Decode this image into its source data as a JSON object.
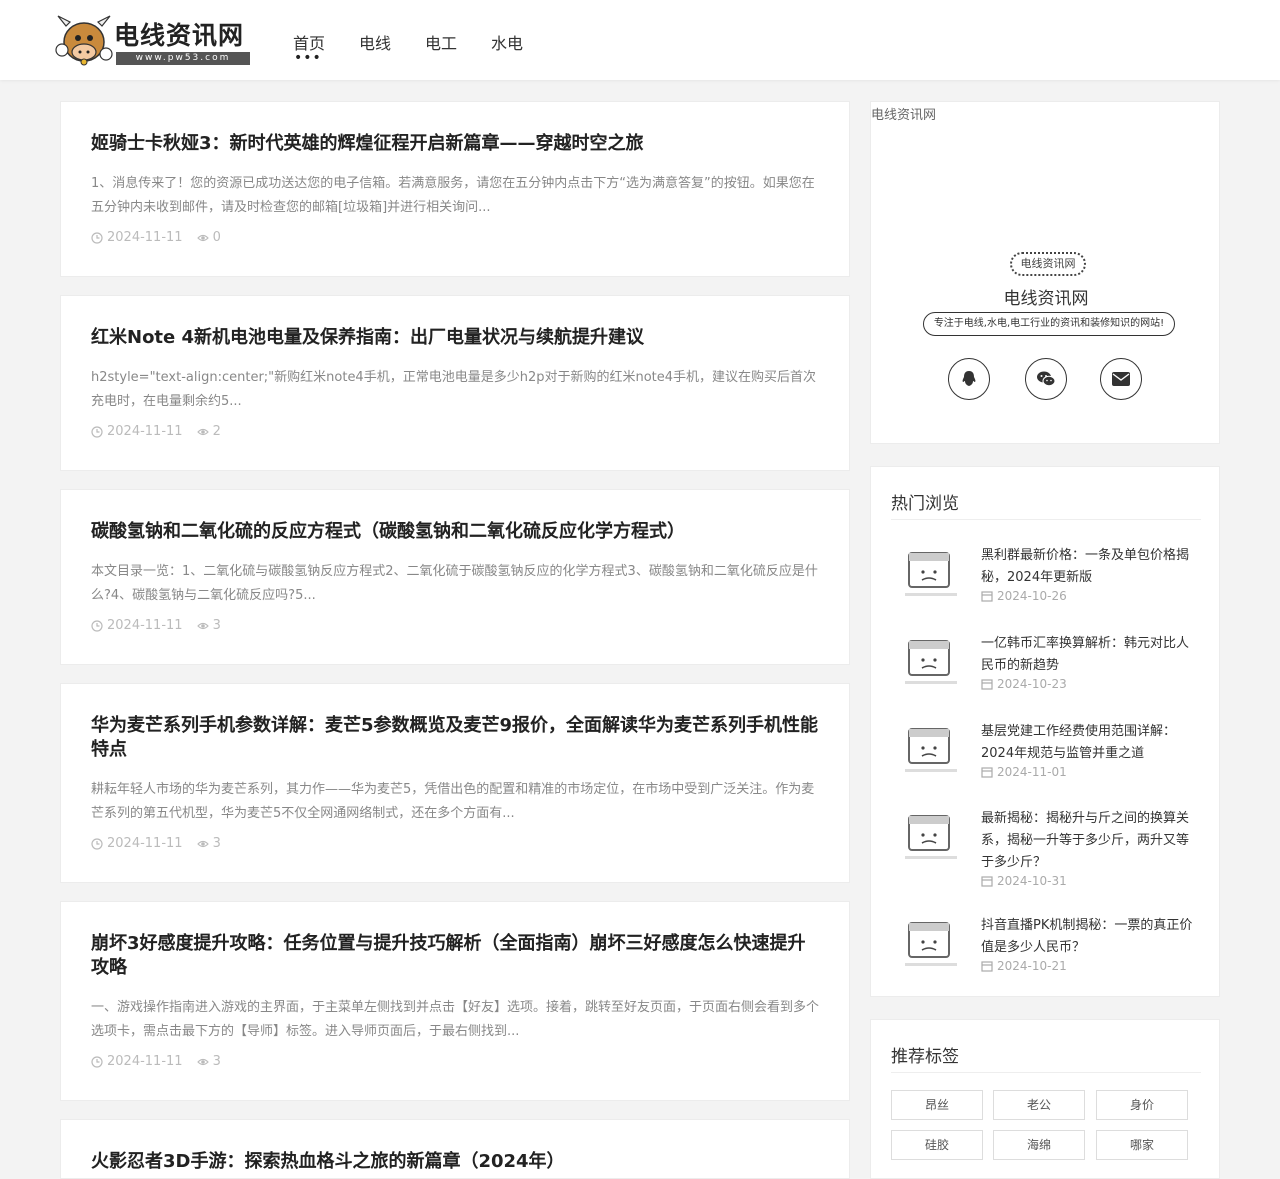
{
  "site": {
    "logo_title": "电线资讯网",
    "logo_domain": "www.pw53.com"
  },
  "nav": [
    {
      "label": "首页",
      "active": true
    },
    {
      "label": "电线",
      "active": false
    },
    {
      "label": "电工",
      "active": false
    },
    {
      "label": "水电",
      "active": false
    }
  ],
  "articles": [
    {
      "title": "姬骑士卡秋娅3：新时代英雄的辉煌征程开启新篇章——穿越时空之旅",
      "excerpt": "1、消息传来了！您的资源已成功送达您的电子信箱。若满意服务，请您在五分钟内点击下方“选为满意答复”的按钮。如果您在五分钟内未收到邮件，请及时检查您的邮箱[垃圾箱]并进行相关询问...",
      "date": "2024-11-11",
      "views": "0"
    },
    {
      "title": "红米Note 4新机电池电量及保养指南：出厂电量状况与续航提升建议",
      "excerpt": "h2style=\"text-align:center;\"新购红米note4手机，正常电池电量是多少h2p对于新购的红米note4手机，建议在购买后首次充电时，在电量剩余约5...",
      "date": "2024-11-11",
      "views": "2"
    },
    {
      "title": "碳酸氢钠和二氧化硫的反应方程式（碳酸氢钠和二氧化硫反应化学方程式）",
      "excerpt": "本文目录一览：1、二氧化硫与碳酸氢钠反应方程式2、二氧化硫于碳酸氢钠反应的化学方程式3、碳酸氢钠和二氧化硫反应是什么?4、碳酸氢钠与二氧化硫反应吗?5...",
      "date": "2024-11-11",
      "views": "3"
    },
    {
      "title": "华为麦芒系列手机参数详解：麦芒5参数概览及麦芒9报价，全面解读华为麦芒系列手机性能特点",
      "excerpt": "耕耘年轻人市场的华为麦芒系列，其力作——华为麦芒5，凭借出色的配置和精准的市场定位，在市场中受到广泛关注。作为麦芒系列的第五代机型，华为麦芒5不仅全网通网络制式，还在多个方面有...",
      "date": "2024-11-11",
      "views": "3"
    },
    {
      "title": "崩坏3好感度提升攻略：任务位置与提升技巧解析（全面指南）崩坏三好感度怎么快速提升攻略",
      "excerpt": "一、游戏操作指南进入游戏的主界面，于主菜单左侧找到并点击【好友】选项。接着，跳转至好友页面，于页面右侧会看到多个选项卡，需点击最下方的【导师】标签。进入导师页面后，于最右侧找到...",
      "date": "2024-11-11",
      "views": "3"
    },
    {
      "title": "火影忍者3D手游：探索热血格斗之旅的新篇章（2024年）",
      "excerpt": "",
      "date": "",
      "views": ""
    }
  ],
  "profile": {
    "label": "电线资讯网",
    "badge": "电线资讯网",
    "name": "电线资讯网",
    "desc": "专注于电线,水电,电工行业的资讯和装修知识的网站!",
    "socials": [
      "qq-icon",
      "wechat-icon",
      "email-icon"
    ]
  },
  "hot": {
    "title": "热门浏览",
    "items": [
      {
        "title": "黑利群最新价格：一条及单包价格揭秘，2024年更新版",
        "date": "2024-10-26"
      },
      {
        "title": "一亿韩币汇率换算解析：韩元对比人民币的新趋势",
        "date": "2024-10-23"
      },
      {
        "title": "基层党建工作经费使用范围详解：2024年规范与监管并重之道",
        "date": "2024-11-01"
      },
      {
        "title": "最新揭秘：揭秘升与斤之间的换算关系，揭秘一升等于多少斤，两升又等于多少斤？",
        "date": "2024-10-31"
      },
      {
        "title": "抖音直播PK机制揭秘：一票的真正价值是多少人民币？",
        "date": "2024-10-21"
      }
    ]
  },
  "tags": {
    "title": "推荐标签",
    "items": [
      "昂丝",
      "老公",
      "身价",
      "硅胶",
      "海绵",
      "哪家"
    ]
  },
  "colors": {
    "background": "#f3f3f3",
    "card": "#ffffff",
    "text": "#333333",
    "muted": "#888888"
  }
}
